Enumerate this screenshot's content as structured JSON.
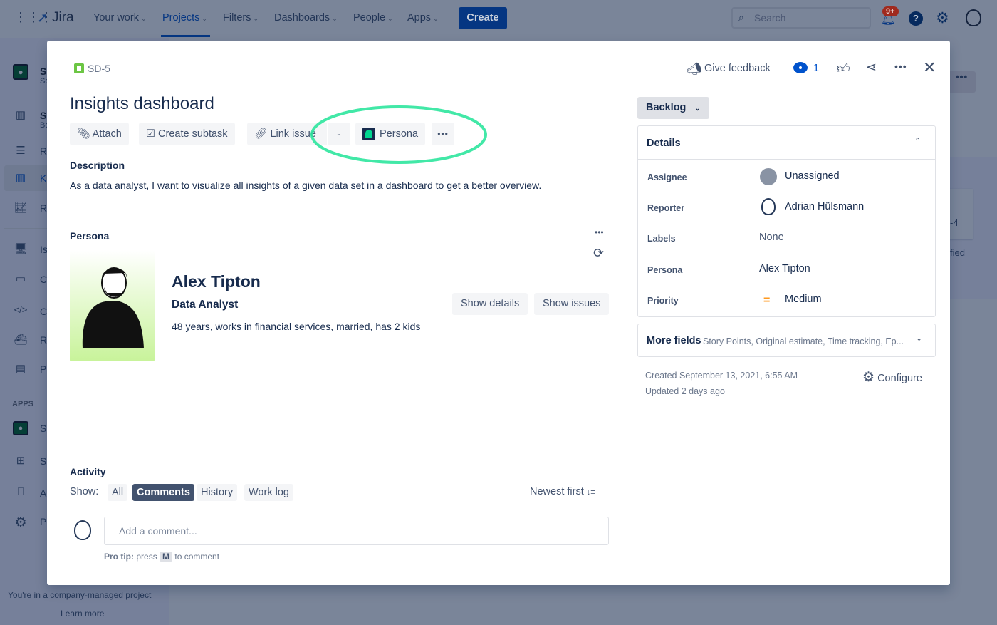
{
  "topbar": {
    "product": "Jira",
    "nav": [
      {
        "label": "Your work"
      },
      {
        "label": "Projects"
      },
      {
        "label": "Filters"
      },
      {
        "label": "Dashboards"
      },
      {
        "label": "People"
      },
      {
        "label": "Apps"
      }
    ],
    "create_label": "Create",
    "search_placeholder": "Search",
    "notification_badge": "9+"
  },
  "sidebar": {
    "items": [
      {
        "label": "S",
        "sub": "Sc"
      },
      {
        "label": "SI",
        "sub": "Bo"
      },
      {
        "label": "Re"
      },
      {
        "label": "Ka"
      },
      {
        "label": "Re"
      },
      {
        "label": "Is"
      },
      {
        "label": "C"
      },
      {
        "label": "C"
      },
      {
        "label": "R"
      },
      {
        "label": "P"
      }
    ],
    "apps_heading": "APPS",
    "apps": [
      {
        "label": "S"
      },
      {
        "label": "S"
      },
      {
        "label": "A"
      },
      {
        "label": "P"
      }
    ],
    "footer_text": "You're in a company-managed project",
    "learn_more": "Learn more"
  },
  "background": {
    "frag1": "-4",
    "frag2": "fied"
  },
  "issue": {
    "key": "SD-5",
    "title": "Insights dashboard",
    "actions": {
      "attach": "Attach",
      "create_subtask": "Create subtask",
      "link_issue": "Link issue",
      "persona": "Persona"
    },
    "description_heading": "Description",
    "description": "As a data analyst, I want to visualize all insights of a given data set in a dashboard to get a better overview.",
    "persona": {
      "heading": "Persona",
      "name": "Alex Tipton",
      "role": "Data Analyst",
      "summary": "48 years, works in financial services, married, has 2 kids",
      "show_details": "Show details",
      "show_issues": "Show issues"
    },
    "activity": {
      "heading": "Activity",
      "show_label": "Show:",
      "tabs": [
        "All",
        "Comments",
        "History",
        "Work log"
      ],
      "active_tab": "Comments",
      "sort": "Newest first",
      "comment_placeholder": "Add a comment...",
      "pro_tip_bold": "Pro tip:",
      "pro_tip_press": "press",
      "pro_tip_key": "M",
      "pro_tip_rest": "to comment"
    }
  },
  "header_actions": {
    "feedback": "Give feedback",
    "watchers": "1"
  },
  "status": "Backlog",
  "details": {
    "heading": "Details",
    "fields": [
      {
        "label": "Assignee",
        "value": "Unassigned"
      },
      {
        "label": "Reporter",
        "value": "Adrian Hülsmann"
      },
      {
        "label": "Labels",
        "value": "None"
      },
      {
        "label": "Persona",
        "value": "Alex Tipton"
      },
      {
        "label": "Priority",
        "value": "Medium"
      }
    ],
    "more_fields": "More fields",
    "more_fields_hint": "Story Points, Original estimate, Time tracking, Ep...",
    "created": "Created September 13, 2021, 6:55 AM",
    "updated": "Updated 2 days ago",
    "configure": "Configure"
  },
  "colors": {
    "accent": "#0052cc",
    "persona_green": "#00d68f",
    "highlight": "#2ee59d",
    "priority": "#ff991f"
  }
}
